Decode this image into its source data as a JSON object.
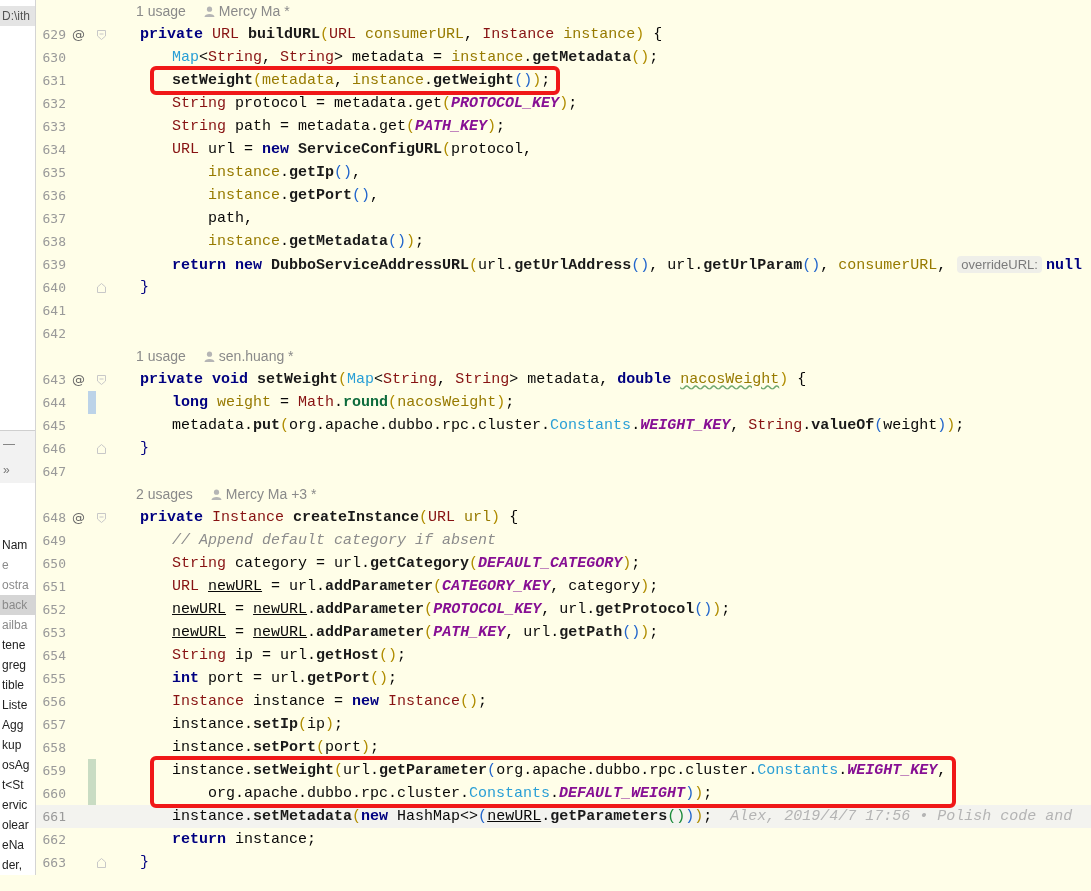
{
  "project_panel": {
    "path": "D:\\ith",
    "minimize": "—",
    "expand": "»",
    "items": [
      {
        "label": "Nam",
        "selected": false,
        "dimmed": false
      },
      {
        "label": "e",
        "selected": false,
        "dimmed": true
      },
      {
        "label": "ostra",
        "selected": false,
        "dimmed": true
      },
      {
        "label": "back",
        "selected": true,
        "dimmed": true
      },
      {
        "label": "ailba",
        "selected": false,
        "dimmed": true
      },
      {
        "label": "tene",
        "selected": false,
        "dimmed": false
      },
      {
        "label": "greg",
        "selected": false,
        "dimmed": false
      },
      {
        "label": "tible",
        "selected": false,
        "dimmed": false
      },
      {
        "label": "Liste",
        "selected": false,
        "dimmed": false
      },
      {
        "label": "Agg",
        "selected": false,
        "dimmed": false
      },
      {
        "label": "kup",
        "selected": false,
        "dimmed": false
      },
      {
        "label": "osAg",
        "selected": false,
        "dimmed": false
      },
      {
        "label": "t<St",
        "selected": false,
        "dimmed": false
      },
      {
        "label": "ervic",
        "selected": false,
        "dimmed": false
      },
      {
        "label": "olear",
        "selected": false,
        "dimmed": false
      },
      {
        "label": "eNa",
        "selected": false,
        "dimmed": false
      },
      {
        "label": "der,",
        "selected": false,
        "dimmed": false
      }
    ]
  },
  "lines": [
    {
      "kind": "usage",
      "usages": "1 usage",
      "author": "Mercy Ma *"
    },
    {
      "kind": "code",
      "number": "629",
      "marker": "@",
      "fold_start": true,
      "tokens": [
        {
          "kind": "kw",
          "text": "private "
        },
        {
          "kind": "cls",
          "text": "URL "
        },
        {
          "kind": "m",
          "text": "buildURL"
        },
        {
          "kind": "b",
          "text": "("
        },
        {
          "kind": "cls",
          "text": "URL "
        },
        {
          "kind": "v",
          "text": "consumerURL"
        },
        {
          "kind": "p",
          "text": ", "
        },
        {
          "kind": "cls",
          "text": "Instance "
        },
        {
          "kind": "v",
          "text": "instance"
        },
        {
          "kind": "b",
          "text": ")"
        },
        {
          "kind": "p",
          "text": " {"
        }
      ]
    },
    {
      "kind": "code",
      "number": "630",
      "tokens": [
        {
          "kind": "if",
          "text": "    Map"
        },
        {
          "kind": "p",
          "text": "<"
        },
        {
          "kind": "cls",
          "text": "String"
        },
        {
          "kind": "p",
          "text": ", "
        },
        {
          "kind": "cls",
          "text": "String"
        },
        {
          "kind": "p",
          "text": "> metadata = "
        },
        {
          "kind": "v",
          "text": "instance"
        },
        {
          "kind": "p",
          "text": "."
        },
        {
          "kind": "m",
          "text": "getMetadata"
        },
        {
          "kind": "b",
          "text": "()"
        },
        {
          "kind": "p",
          "text": ";"
        }
      ]
    },
    {
      "kind": "code",
      "number": "631",
      "boxed": true,
      "tokens": [
        {
          "kind": "m",
          "text": "    setWeight"
        },
        {
          "kind": "b",
          "text": "("
        },
        {
          "kind": "v",
          "text": "metadata"
        },
        {
          "kind": "p",
          "text": ", "
        },
        {
          "kind": "v",
          "text": "instance"
        },
        {
          "kind": "p",
          "text": "."
        },
        {
          "kind": "m",
          "text": "getWeight"
        },
        {
          "kind": "b2",
          "text": "()"
        },
        {
          "kind": "b",
          "text": ")"
        },
        {
          "kind": "p",
          "text": ";"
        }
      ]
    },
    {
      "kind": "code",
      "number": "632",
      "tokens": [
        {
          "kind": "cls",
          "text": "    String "
        },
        {
          "kind": "p",
          "text": "protocol = metadata.get"
        },
        {
          "kind": "b",
          "text": "("
        },
        {
          "kind": "c",
          "text": "PROTOCOL_KEY"
        },
        {
          "kind": "b",
          "text": ")"
        },
        {
          "kind": "p",
          "text": ";"
        }
      ]
    },
    {
      "kind": "code",
      "number": "633",
      "tokens": [
        {
          "kind": "cls",
          "text": "    String "
        },
        {
          "kind": "p",
          "text": "path = metadata.get"
        },
        {
          "kind": "b",
          "text": "("
        },
        {
          "kind": "c",
          "text": "PATH_KEY"
        },
        {
          "kind": "b",
          "text": ")"
        },
        {
          "kind": "p",
          "text": ";"
        }
      ]
    },
    {
      "kind": "code",
      "number": "634",
      "tokens": [
        {
          "kind": "cls",
          "text": "    URL "
        },
        {
          "kind": "p",
          "text": "url = "
        },
        {
          "kind": "kw",
          "text": "new "
        },
        {
          "kind": "m",
          "text": "ServiceConfigURL"
        },
        {
          "kind": "b",
          "text": "("
        },
        {
          "kind": "p",
          "text": "protocol,"
        }
      ]
    },
    {
      "kind": "code",
      "number": "635",
      "tokens": [
        {
          "kind": "v",
          "text": "        instance"
        },
        {
          "kind": "p",
          "text": "."
        },
        {
          "kind": "m",
          "text": "getIp"
        },
        {
          "kind": "b2",
          "text": "()"
        },
        {
          "kind": "p",
          "text": ","
        }
      ]
    },
    {
      "kind": "code",
      "number": "636",
      "tokens": [
        {
          "kind": "v",
          "text": "        instance"
        },
        {
          "kind": "p",
          "text": "."
        },
        {
          "kind": "m",
          "text": "getPort"
        },
        {
          "kind": "b2",
          "text": "()"
        },
        {
          "kind": "p",
          "text": ","
        }
      ]
    },
    {
      "kind": "code",
      "number": "637",
      "tokens": [
        {
          "kind": "p",
          "text": "        path,"
        }
      ]
    },
    {
      "kind": "code",
      "number": "638",
      "tokens": [
        {
          "kind": "v",
          "text": "        instance"
        },
        {
          "kind": "p",
          "text": "."
        },
        {
          "kind": "m",
          "text": "getMetadata"
        },
        {
          "kind": "b2",
          "text": "()"
        },
        {
          "kind": "b",
          "text": ")"
        },
        {
          "kind": "p",
          "text": ";"
        }
      ]
    },
    {
      "kind": "code",
      "number": "639",
      "tokens": [
        {
          "kind": "kw",
          "text": "    return new "
        },
        {
          "kind": "m",
          "text": "DubboServiceAddressURL"
        },
        {
          "kind": "b",
          "text": "("
        },
        {
          "kind": "p",
          "text": "url."
        },
        {
          "kind": "m",
          "text": "getUrlAddress"
        },
        {
          "kind": "b2",
          "text": "()"
        },
        {
          "kind": "p",
          "text": ", url."
        },
        {
          "kind": "m",
          "text": "getUrlParam"
        },
        {
          "kind": "b2",
          "text": "()"
        },
        {
          "kind": "p",
          "text": ", "
        },
        {
          "kind": "v",
          "text": "consumerURL"
        },
        {
          "kind": "p",
          "text": ", "
        },
        {
          "kind": "hint",
          "text": "overrideURL:"
        },
        {
          "kind": "kw",
          "text": "null"
        }
      ]
    },
    {
      "kind": "code",
      "number": "640",
      "fold_end": true,
      "tokens": [
        {
          "kind": "kw2",
          "text": "}"
        }
      ]
    },
    {
      "kind": "code",
      "number": "641"
    },
    {
      "kind": "code",
      "number": "642"
    },
    {
      "kind": "usage",
      "usages": "1 usage",
      "author": "sen.huang *"
    },
    {
      "kind": "code",
      "number": "643",
      "marker": "@",
      "fold_start": true,
      "tokens": [
        {
          "kind": "kw",
          "text": "private void "
        },
        {
          "kind": "m",
          "text": "setWeight"
        },
        {
          "kind": "b",
          "text": "("
        },
        {
          "kind": "if",
          "text": "Map"
        },
        {
          "kind": "p",
          "text": "<"
        },
        {
          "kind": "cls",
          "text": "String"
        },
        {
          "kind": "p",
          "text": ", "
        },
        {
          "kind": "cls",
          "text": "String"
        },
        {
          "kind": "p",
          "text": "> metadata, "
        },
        {
          "kind": "kw",
          "text": "double "
        },
        {
          "kind": "typo",
          "text": "nacosWeight"
        },
        {
          "kind": "b",
          "text": ")"
        },
        {
          "kind": "p",
          "text": " {"
        }
      ]
    },
    {
      "kind": "code",
      "number": "644",
      "modified": true,
      "tokens": [
        {
          "kind": "kw",
          "text": "    long "
        },
        {
          "kind": "v",
          "text": "weight"
        },
        {
          "kind": "p",
          "text": " = "
        },
        {
          "kind": "cls",
          "text": "Math"
        },
        {
          "kind": "p",
          "text": "."
        },
        {
          "kind": "sm",
          "text": "round"
        },
        {
          "kind": "b",
          "text": "("
        },
        {
          "kind": "v",
          "text": "nacosWeight"
        },
        {
          "kind": "b",
          "text": ")"
        },
        {
          "kind": "p",
          "text": ";"
        }
      ]
    },
    {
      "kind": "code",
      "number": "645",
      "tokens": [
        {
          "kind": "p",
          "text": "    metadata."
        },
        {
          "kind": "m",
          "text": "put"
        },
        {
          "kind": "b",
          "text": "("
        },
        {
          "kind": "p",
          "text": "org.apache.dubbo.rpc.cluster."
        },
        {
          "kind": "if",
          "text": "Constants"
        },
        {
          "kind": "p",
          "text": "."
        },
        {
          "kind": "c",
          "text": "WEIGHT_KEY"
        },
        {
          "kind": "p",
          "text": ", "
        },
        {
          "kind": "cls",
          "text": "String"
        },
        {
          "kind": "p",
          "text": "."
        },
        {
          "kind": "m",
          "text": "valueOf"
        },
        {
          "kind": "b2",
          "text": "("
        },
        {
          "kind": "p",
          "text": "weight"
        },
        {
          "kind": "b2",
          "text": ")"
        },
        {
          "kind": "b",
          "text": ")"
        },
        {
          "kind": "p",
          "text": ";"
        }
      ]
    },
    {
      "kind": "code",
      "number": "646",
      "fold_end": true,
      "tokens": [
        {
          "kind": "kw2",
          "text": "}"
        }
      ]
    },
    {
      "kind": "code",
      "number": "647"
    },
    {
      "kind": "usage",
      "usages": "2 usages",
      "author": "Mercy Ma +3 *"
    },
    {
      "kind": "code",
      "number": "648",
      "marker": "@",
      "fold_start": true,
      "tokens": [
        {
          "kind": "kw",
          "text": "private "
        },
        {
          "kind": "cls",
          "text": "Instance "
        },
        {
          "kind": "m",
          "text": "createInstance"
        },
        {
          "kind": "b",
          "text": "("
        },
        {
          "kind": "cls",
          "text": "URL "
        },
        {
          "kind": "v",
          "text": "url"
        },
        {
          "kind": "b",
          "text": ")"
        },
        {
          "kind": "p",
          "text": " {"
        }
      ]
    },
    {
      "kind": "code",
      "number": "649",
      "tokens": [
        {
          "kind": "cm",
          "text": "    // Append default category if absent"
        }
      ]
    },
    {
      "kind": "code",
      "number": "650",
      "tokens": [
        {
          "kind": "cls",
          "text": "    String "
        },
        {
          "kind": "p",
          "text": "category = url."
        },
        {
          "kind": "m",
          "text": "getCategory"
        },
        {
          "kind": "b",
          "text": "("
        },
        {
          "kind": "c",
          "text": "DEFAULT_CATEGORY"
        },
        {
          "kind": "b",
          "text": ")"
        },
        {
          "kind": "p",
          "text": ";"
        }
      ]
    },
    {
      "kind": "code",
      "number": "651",
      "tokens": [
        {
          "kind": "cls",
          "text": "    URL "
        },
        {
          "kind": "u",
          "text": "newURL"
        },
        {
          "kind": "p",
          "text": " = url."
        },
        {
          "kind": "m",
          "text": "addParameter"
        },
        {
          "kind": "b",
          "text": "("
        },
        {
          "kind": "c",
          "text": "CATEGORY_KEY"
        },
        {
          "kind": "p",
          "text": ", category"
        },
        {
          "kind": "b",
          "text": ")"
        },
        {
          "kind": "p",
          "text": ";"
        }
      ]
    },
    {
      "kind": "code",
      "number": "652",
      "tokens": [
        {
          "kind": "u",
          "text": "    newURL"
        },
        {
          "kind": "p",
          "text": " = "
        },
        {
          "kind": "u",
          "text": "newURL"
        },
        {
          "kind": "p",
          "text": "."
        },
        {
          "kind": "m",
          "text": "addParameter"
        },
        {
          "kind": "b",
          "text": "("
        },
        {
          "kind": "c",
          "text": "PROTOCOL_KEY"
        },
        {
          "kind": "p",
          "text": ", url."
        },
        {
          "kind": "m",
          "text": "getProtocol"
        },
        {
          "kind": "b2",
          "text": "()"
        },
        {
          "kind": "b",
          "text": ")"
        },
        {
          "kind": "p",
          "text": ";"
        }
      ]
    },
    {
      "kind": "code",
      "number": "653",
      "tokens": [
        {
          "kind": "u",
          "text": "    newURL"
        },
        {
          "kind": "p",
          "text": " = "
        },
        {
          "kind": "u",
          "text": "newURL"
        },
        {
          "kind": "p",
          "text": "."
        },
        {
          "kind": "m",
          "text": "addParameter"
        },
        {
          "kind": "b",
          "text": "("
        },
        {
          "kind": "c",
          "text": "PATH_KEY"
        },
        {
          "kind": "p",
          "text": ", url."
        },
        {
          "kind": "m",
          "text": "getPath"
        },
        {
          "kind": "b2",
          "text": "()"
        },
        {
          "kind": "b",
          "text": ")"
        },
        {
          "kind": "p",
          "text": ";"
        }
      ]
    },
    {
      "kind": "code",
      "number": "654",
      "tokens": [
        {
          "kind": "cls",
          "text": "    String "
        },
        {
          "kind": "p",
          "text": "ip = url."
        },
        {
          "kind": "m",
          "text": "getHost"
        },
        {
          "kind": "b",
          "text": "()"
        },
        {
          "kind": "p",
          "text": ";"
        }
      ]
    },
    {
      "kind": "code",
      "number": "655",
      "tokens": [
        {
          "kind": "kw",
          "text": "    int "
        },
        {
          "kind": "p",
          "text": "port = url."
        },
        {
          "kind": "m",
          "text": "getPort"
        },
        {
          "kind": "b",
          "text": "()"
        },
        {
          "kind": "p",
          "text": ";"
        }
      ]
    },
    {
      "kind": "code",
      "number": "656",
      "tokens": [
        {
          "kind": "cls",
          "text": "    Instance "
        },
        {
          "kind": "p",
          "text": "instance = "
        },
        {
          "kind": "kw",
          "text": "new "
        },
        {
          "kind": "cls",
          "text": "Instance"
        },
        {
          "kind": "b",
          "text": "()"
        },
        {
          "kind": "p",
          "text": ";"
        }
      ]
    },
    {
      "kind": "code",
      "number": "657",
      "tokens": [
        {
          "kind": "p",
          "text": "    instance."
        },
        {
          "kind": "m",
          "text": "setIp"
        },
        {
          "kind": "b",
          "text": "("
        },
        {
          "kind": "p",
          "text": "ip"
        },
        {
          "kind": "b",
          "text": ")"
        },
        {
          "kind": "p",
          "text": ";"
        }
      ]
    },
    {
      "kind": "code",
      "number": "658",
      "tokens": [
        {
          "kind": "p",
          "text": "    instance."
        },
        {
          "kind": "m",
          "text": "setPort"
        },
        {
          "kind": "b",
          "text": "("
        },
        {
          "kind": "p",
          "text": "port"
        },
        {
          "kind": "b",
          "text": ")"
        },
        {
          "kind": "p",
          "text": ";"
        }
      ]
    },
    {
      "kind": "code",
      "number": "659",
      "added": true,
      "boxed": true,
      "tokens": [
        {
          "kind": "p",
          "text": "    instance."
        },
        {
          "kind": "m",
          "text": "setWeight"
        },
        {
          "kind": "b",
          "text": "("
        },
        {
          "kind": "p",
          "text": "url."
        },
        {
          "kind": "m",
          "text": "getParameter"
        },
        {
          "kind": "b2",
          "text": "("
        },
        {
          "kind": "p",
          "text": "org.apache.dubbo.rpc.cluster."
        },
        {
          "kind": "if",
          "text": "Constants"
        },
        {
          "kind": "p",
          "text": "."
        },
        {
          "kind": "c",
          "text": "WEIGHT_KEY"
        },
        {
          "kind": "p",
          "text": ","
        }
      ]
    },
    {
      "kind": "code",
      "number": "660",
      "added": true,
      "boxed": true,
      "tokens": [
        {
          "kind": "p",
          "text": "        org.apache.dubbo.rpc.cluster."
        },
        {
          "kind": "if",
          "text": "Constants"
        },
        {
          "kind": "p",
          "text": "."
        },
        {
          "kind": "c",
          "text": "DEFAULT_WEIGHT"
        },
        {
          "kind": "b2",
          "text": ")"
        },
        {
          "kind": "b",
          "text": ")"
        },
        {
          "kind": "p",
          "text": ";"
        }
      ]
    },
    {
      "kind": "code",
      "number": "661",
      "current": true,
      "blame": "Alex, 2019/4/7 17:56 • Polish code and",
      "tokens": [
        {
          "kind": "p",
          "text": "    instance."
        },
        {
          "kind": "m",
          "text": "setMetadata"
        },
        {
          "kind": "b",
          "text": "("
        },
        {
          "kind": "kw",
          "text": "new "
        },
        {
          "kind": "p",
          "text": "HashMap<>"
        },
        {
          "kind": "b2",
          "text": "("
        },
        {
          "kind": "u",
          "text": "newURL"
        },
        {
          "kind": "p",
          "text": "."
        },
        {
          "kind": "m",
          "text": "getParameters"
        },
        {
          "kind": "b3",
          "text": "()"
        },
        {
          "kind": "b2",
          "text": ")"
        },
        {
          "kind": "b",
          "text": ")"
        },
        {
          "kind": "p",
          "text": ";"
        }
      ]
    },
    {
      "kind": "code",
      "number": "662",
      "tokens": [
        {
          "kind": "kw",
          "text": "    return "
        },
        {
          "kind": "p",
          "text": "instance;"
        }
      ]
    },
    {
      "kind": "code",
      "number": "663",
      "fold_end": true,
      "tokens": [
        {
          "kind": "kw2",
          "text": "}"
        }
      ]
    }
  ]
}
